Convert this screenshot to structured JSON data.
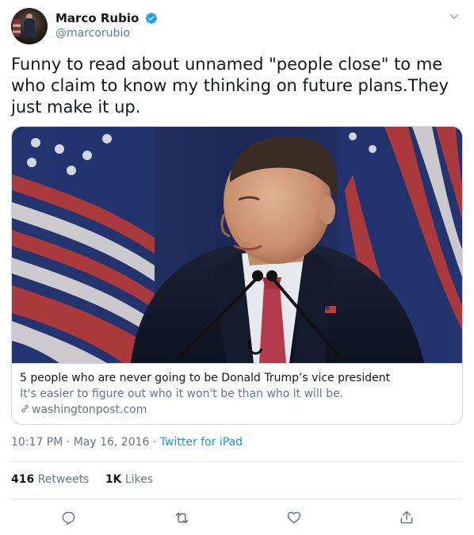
{
  "user": {
    "display_name": "Marco Rubio",
    "handle": "@marcorubio",
    "verified": true
  },
  "tweet": {
    "text": "Funny to read about unnamed \"people close\" to me who claim to know my thinking on future plans.They just make it up."
  },
  "card": {
    "title": "5 people who are never going to be Donald Trump’s vice president",
    "description": "It's easier to figure out who it won't be than who it will be.",
    "domain": "washingtonpost.com"
  },
  "meta": {
    "time": "10:17 PM",
    "separator1": " · ",
    "date": "May 16, 2016",
    "separator2": " · ",
    "source": "Twitter for iPad"
  },
  "stats": {
    "retweets_count": "416",
    "retweets_label": "Retweets",
    "likes_count": "1K",
    "likes_label": "Likes"
  },
  "colors": {
    "verified": "#1da1f2",
    "link": "#1b95e0",
    "muted": "#657786",
    "border": "#ccd6dd"
  },
  "icons": {
    "reply": "reply-icon",
    "retweet": "retweet-icon",
    "like": "like-icon",
    "share": "share-icon",
    "caret": "chevron-down-icon"
  }
}
